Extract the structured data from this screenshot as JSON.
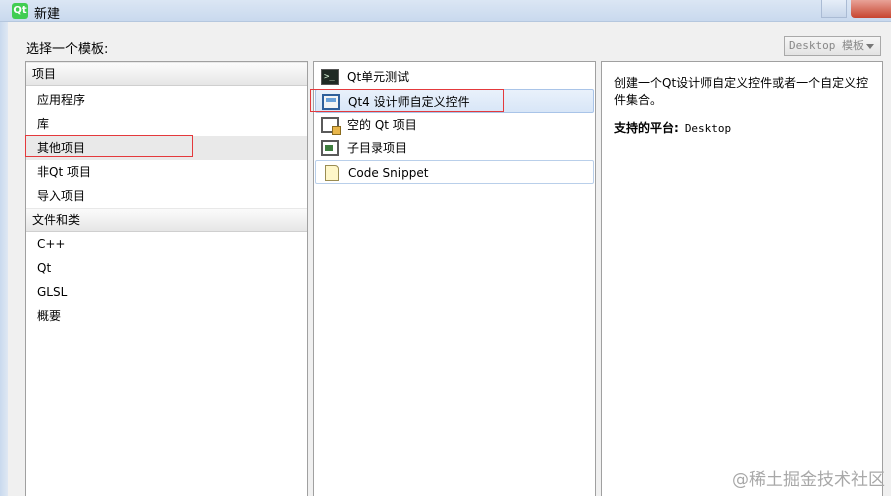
{
  "window": {
    "title": "新建",
    "app_icon_text": "Qt"
  },
  "choose_label": "选择一个模板:",
  "platform_combo": {
    "value": "Desktop 模板"
  },
  "categories": {
    "project_header": "项目",
    "project_items": [
      "应用程序",
      "库",
      "其他项目",
      "非Qt 项目",
      "导入项目"
    ],
    "selected_project_item": "其他项目",
    "files_header": "文件和类",
    "file_items": [
      "C++",
      "Qt",
      "GLSL",
      "概要"
    ]
  },
  "templates": [
    {
      "label": "Qt单元测试",
      "icon": "terminal-icon"
    },
    {
      "label": "Qt4 设计师自定义控件",
      "icon": "designer-widget-icon",
      "selected": true
    },
    {
      "label": "空的 Qt 项目",
      "icon": "window-icon"
    },
    {
      "label": "子目录项目",
      "icon": "folder-project-icon"
    },
    {
      "label": "Code Snippet",
      "icon": "document-icon"
    }
  ],
  "details": {
    "description": "创建一个Qt设计师自定义控件或者一个自定义控件集合。",
    "platform_label": "支持的平台:",
    "platform_value": "Desktop"
  },
  "watermark": "@稀土掘金技术社区",
  "colors": {
    "highlight_box": "#e4393c",
    "selection_blue": "#d8e6f7"
  }
}
